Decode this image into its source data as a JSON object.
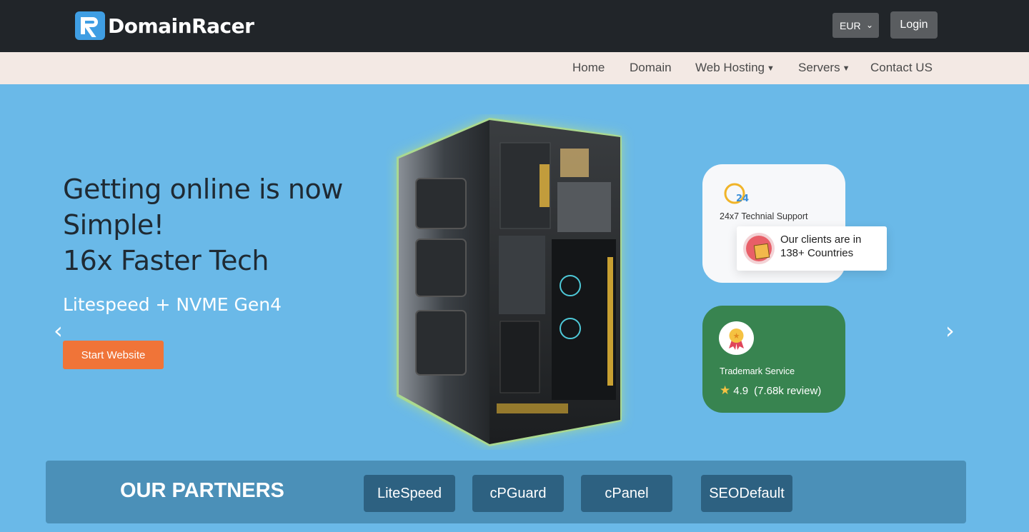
{
  "header": {
    "brand": "DomainRacer",
    "currency": "EUR",
    "login_label": "Login"
  },
  "nav": {
    "items": [
      {
        "label": "Home"
      },
      {
        "label": "Domain"
      },
      {
        "label": "Web Hosting"
      },
      {
        "label": "Servers"
      },
      {
        "label": "Contact US"
      }
    ]
  },
  "hero": {
    "title_lines": [
      "Getting online is now",
      "Simple!",
      "16x Faster Tech"
    ],
    "subtitle": "Litespeed + NVME Gen4",
    "cta_label": "Start Website",
    "prev_arrow": "‹",
    "next_arrow": "›"
  },
  "cards": {
    "support": {
      "icon": "clock-24-icon",
      "label": "24x7 Technial Support"
    },
    "clients": {
      "icon": "package-box-icon",
      "line1": "Our clients are in",
      "line2": "138+ Countries"
    },
    "trademark": {
      "icon": "award-medal-icon",
      "label": "Trademark Service",
      "rating": "4.9",
      "reviews": "(7.68k review)"
    }
  },
  "partners": {
    "title": "OUR PARTNERS",
    "items": [
      {
        "label": "LiteSpeed"
      },
      {
        "label": "cPGuard"
      },
      {
        "label": "cPanel"
      },
      {
        "label": "SEODefault"
      }
    ]
  },
  "colors": {
    "topbar": "#212529",
    "nav_bg": "#f3e9e4",
    "hero_bg": "#6ab9e8",
    "cta": "#f07438",
    "trademark_card": "#388450",
    "partners_bg": "#4b90b8",
    "partner_btn": "#2d6181"
  }
}
